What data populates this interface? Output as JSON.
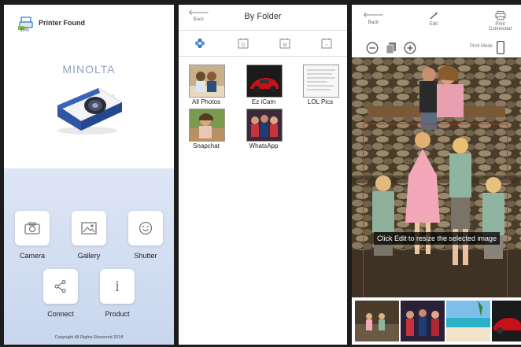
{
  "home": {
    "status_text": "Printer Found",
    "battery": "30%",
    "brand": "MINOLTA",
    "buttons": [
      {
        "label": "Camera",
        "icon": "camera-icon"
      },
      {
        "label": "Gallery",
        "icon": "gallery-icon"
      },
      {
        "label": "Shutter",
        "icon": "smiley-icon"
      },
      {
        "label": "Connect",
        "icon": "share-icon"
      },
      {
        "label": "Product",
        "icon": "info-icon"
      }
    ],
    "copyright": "Copyright All Rights Reserved 2018",
    "colors": {
      "bottom_bg": "#c8d6ee",
      "brand": "#8fa0c8",
      "camera_body": "#2f55a4"
    }
  },
  "folder": {
    "back_label": "Back",
    "title": "By Folder",
    "tabs": [
      {
        "name": "tab-all",
        "icon": "flower-icon"
      },
      {
        "name": "tab-day",
        "icon": "calendar-d-icon",
        "letter": "D"
      },
      {
        "name": "tab-month",
        "icon": "calendar-m-icon",
        "letter": "M"
      },
      {
        "name": "tab-custom",
        "icon": "calendar-check-icon",
        "letter": "✓"
      }
    ],
    "folders": [
      {
        "label": "All Photos"
      },
      {
        "label": "Ez iCam"
      },
      {
        "label": "LOL Pics"
      },
      {
        "label": "Snapchat"
      },
      {
        "label": "WhatsApp"
      }
    ]
  },
  "editor": {
    "back_label": "Back",
    "edit_label": "Edit",
    "print_label": "Print",
    "print_status": "Connected",
    "print_mode_label": "Print Mode",
    "tooltip": "Click Edit to resize the selected image",
    "colors": {
      "selection": "#e02020"
    }
  }
}
